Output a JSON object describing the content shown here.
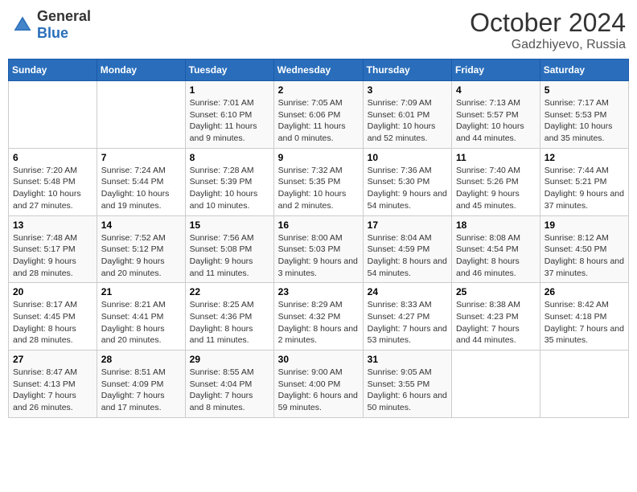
{
  "header": {
    "logo_general": "General",
    "logo_blue": "Blue",
    "month": "October 2024",
    "location": "Gadzhiyevo, Russia"
  },
  "weekdays": [
    "Sunday",
    "Monday",
    "Tuesday",
    "Wednesday",
    "Thursday",
    "Friday",
    "Saturday"
  ],
  "weeks": [
    [
      {
        "day": "",
        "info": ""
      },
      {
        "day": "",
        "info": ""
      },
      {
        "day": "1",
        "info": "Sunrise: 7:01 AM\nSunset: 6:10 PM\nDaylight: 11 hours and 9 minutes."
      },
      {
        "day": "2",
        "info": "Sunrise: 7:05 AM\nSunset: 6:06 PM\nDaylight: 11 hours and 0 minutes."
      },
      {
        "day": "3",
        "info": "Sunrise: 7:09 AM\nSunset: 6:01 PM\nDaylight: 10 hours and 52 minutes."
      },
      {
        "day": "4",
        "info": "Sunrise: 7:13 AM\nSunset: 5:57 PM\nDaylight: 10 hours and 44 minutes."
      },
      {
        "day": "5",
        "info": "Sunrise: 7:17 AM\nSunset: 5:53 PM\nDaylight: 10 hours and 35 minutes."
      }
    ],
    [
      {
        "day": "6",
        "info": "Sunrise: 7:20 AM\nSunset: 5:48 PM\nDaylight: 10 hours and 27 minutes."
      },
      {
        "day": "7",
        "info": "Sunrise: 7:24 AM\nSunset: 5:44 PM\nDaylight: 10 hours and 19 minutes."
      },
      {
        "day": "8",
        "info": "Sunrise: 7:28 AM\nSunset: 5:39 PM\nDaylight: 10 hours and 10 minutes."
      },
      {
        "day": "9",
        "info": "Sunrise: 7:32 AM\nSunset: 5:35 PM\nDaylight: 10 hours and 2 minutes."
      },
      {
        "day": "10",
        "info": "Sunrise: 7:36 AM\nSunset: 5:30 PM\nDaylight: 9 hours and 54 minutes."
      },
      {
        "day": "11",
        "info": "Sunrise: 7:40 AM\nSunset: 5:26 PM\nDaylight: 9 hours and 45 minutes."
      },
      {
        "day": "12",
        "info": "Sunrise: 7:44 AM\nSunset: 5:21 PM\nDaylight: 9 hours and 37 minutes."
      }
    ],
    [
      {
        "day": "13",
        "info": "Sunrise: 7:48 AM\nSunset: 5:17 PM\nDaylight: 9 hours and 28 minutes."
      },
      {
        "day": "14",
        "info": "Sunrise: 7:52 AM\nSunset: 5:12 PM\nDaylight: 9 hours and 20 minutes."
      },
      {
        "day": "15",
        "info": "Sunrise: 7:56 AM\nSunset: 5:08 PM\nDaylight: 9 hours and 11 minutes."
      },
      {
        "day": "16",
        "info": "Sunrise: 8:00 AM\nSunset: 5:03 PM\nDaylight: 9 hours and 3 minutes."
      },
      {
        "day": "17",
        "info": "Sunrise: 8:04 AM\nSunset: 4:59 PM\nDaylight: 8 hours and 54 minutes."
      },
      {
        "day": "18",
        "info": "Sunrise: 8:08 AM\nSunset: 4:54 PM\nDaylight: 8 hours and 46 minutes."
      },
      {
        "day": "19",
        "info": "Sunrise: 8:12 AM\nSunset: 4:50 PM\nDaylight: 8 hours and 37 minutes."
      }
    ],
    [
      {
        "day": "20",
        "info": "Sunrise: 8:17 AM\nSunset: 4:45 PM\nDaylight: 8 hours and 28 minutes."
      },
      {
        "day": "21",
        "info": "Sunrise: 8:21 AM\nSunset: 4:41 PM\nDaylight: 8 hours and 20 minutes."
      },
      {
        "day": "22",
        "info": "Sunrise: 8:25 AM\nSunset: 4:36 PM\nDaylight: 8 hours and 11 minutes."
      },
      {
        "day": "23",
        "info": "Sunrise: 8:29 AM\nSunset: 4:32 PM\nDaylight: 8 hours and 2 minutes."
      },
      {
        "day": "24",
        "info": "Sunrise: 8:33 AM\nSunset: 4:27 PM\nDaylight: 7 hours and 53 minutes."
      },
      {
        "day": "25",
        "info": "Sunrise: 8:38 AM\nSunset: 4:23 PM\nDaylight: 7 hours and 44 minutes."
      },
      {
        "day": "26",
        "info": "Sunrise: 8:42 AM\nSunset: 4:18 PM\nDaylight: 7 hours and 35 minutes."
      }
    ],
    [
      {
        "day": "27",
        "info": "Sunrise: 8:47 AM\nSunset: 4:13 PM\nDaylight: 7 hours and 26 minutes."
      },
      {
        "day": "28",
        "info": "Sunrise: 8:51 AM\nSunset: 4:09 PM\nDaylight: 7 hours and 17 minutes."
      },
      {
        "day": "29",
        "info": "Sunrise: 8:55 AM\nSunset: 4:04 PM\nDaylight: 7 hours and 8 minutes."
      },
      {
        "day": "30",
        "info": "Sunrise: 9:00 AM\nSunset: 4:00 PM\nDaylight: 6 hours and 59 minutes."
      },
      {
        "day": "31",
        "info": "Sunrise: 9:05 AM\nSunset: 3:55 PM\nDaylight: 6 hours and 50 minutes."
      },
      {
        "day": "",
        "info": ""
      },
      {
        "day": "",
        "info": ""
      }
    ]
  ]
}
